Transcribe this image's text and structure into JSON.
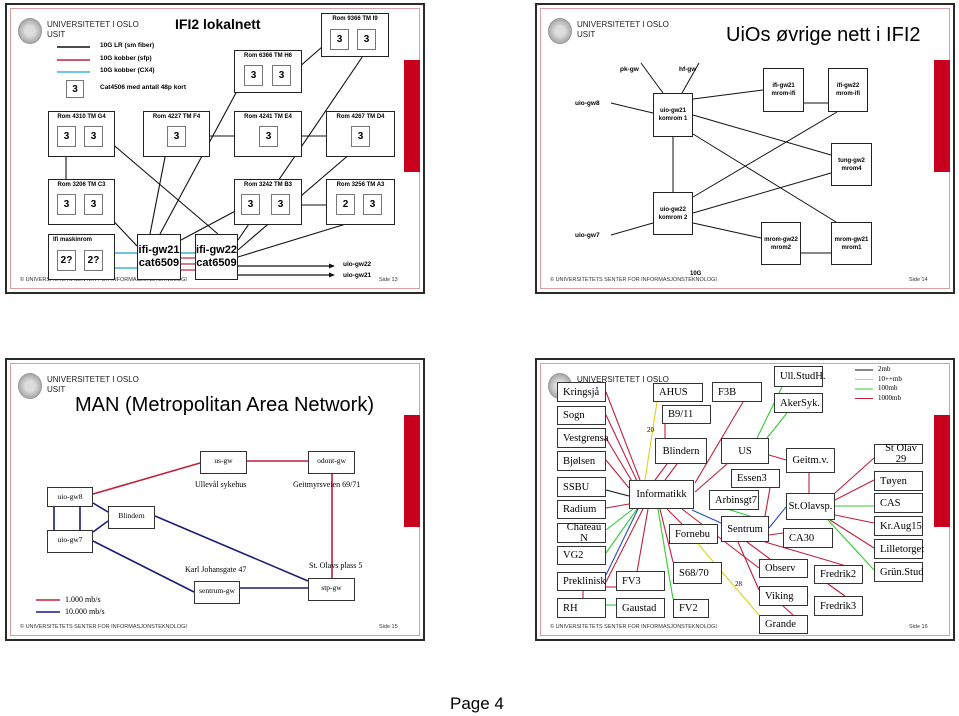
{
  "colors": {
    "accent_bar": "#c8001e",
    "black": "#111111",
    "red": "#c0203a",
    "cyan": "#3cb4dc",
    "navy": "#1c1c78",
    "yellow": "#e0d020",
    "green": "#33cc33",
    "blue": "#2050c0"
  },
  "header": {
    "university": "UNIVERSITETET I OSLO",
    "unit": "USIT"
  },
  "footer": "© UNIVERSITETETS SENTER FOR INFORMASJONSTEKNOLOGI",
  "slides": [
    {
      "title": "IFI2 lokalnett",
      "slide_number": "Side 13",
      "legend": [
        {
          "label": "10G LR (sm fiber)",
          "color": "#111111"
        },
        {
          "label": "10G kobber (sfp)",
          "color": "#c0203a"
        },
        {
          "label": "10G kobber (CX4)",
          "color": "#3cb4dc"
        },
        {
          "label": "Cat4506 med antall 48p kort",
          "symbol": "3"
        }
      ],
      "rooms": [
        {
          "name": "Rom 9366 TM I9",
          "switches": [
            "3",
            "3"
          ]
        },
        {
          "name": "Rom 6366 TM H6",
          "switches": [
            "3",
            "3"
          ]
        },
        {
          "name": "Rom 4310 TM G4",
          "switches": [
            "3",
            "3"
          ]
        },
        {
          "name": "Rom 4227 TM F4",
          "switches": [
            "3"
          ]
        },
        {
          "name": "Rom 4241 TM E4",
          "switches": [
            "3"
          ]
        },
        {
          "name": "Rom 4267 TM D4",
          "switches": [
            "3"
          ]
        },
        {
          "name": "Rom 3206 TM C3",
          "switches": [
            "3",
            "3"
          ]
        },
        {
          "name": "Rom 3242 TM B3",
          "switches": [
            "3",
            "3"
          ]
        },
        {
          "name": "Rom 3256 TM A3",
          "switches": [
            "2",
            "3"
          ]
        },
        {
          "name": "Ifi maskinrom",
          "switches": [
            "2?",
            "2?"
          ]
        }
      ],
      "gateways": [
        "ifi-gw21\ncat6509",
        "ifi-gw22\ncat6509"
      ],
      "uplinks": [
        "uio-gw22",
        "uio-gw21"
      ]
    },
    {
      "title": "UiOs øvrige nett i IFI2",
      "slide_number": "Side 14",
      "nodes": [
        "uio-gw21\nkomrom 1",
        "uio-gw22\nkomrom 2",
        "ifi-gw21\nmrom-ifi",
        "ifi-gw22\nmrom-ifi",
        "tung-gw2\nmrom4",
        "mrom-gw22\nmrom2",
        "mrom-gw21\nmrom1"
      ],
      "external": [
        "pk-gw",
        "hf-gw",
        "uio-gw8",
        "uio-gw7"
      ],
      "annotation": "10G"
    },
    {
      "title": "MAN (Metropolitan Area Network)",
      "slide_number": "Side 15",
      "nodes": [
        "us-gw",
        "odont-gw",
        "uio-gw8",
        "uio-gw7",
        "Blindern",
        "sentrum-gw",
        "stp-gw"
      ],
      "locations": [
        "Ullevål sykehus",
        "Geitmyrsveien 69/71",
        "Karl Johansgate 47",
        "St. Olavs plass 5"
      ],
      "legend": [
        {
          "label": "1.000 mb/s",
          "color": "#c0203a"
        },
        {
          "label": "10.000 mb/s",
          "color": "#1c1c78"
        }
      ]
    },
    {
      "slide_number": "Side 16",
      "legend": [
        {
          "label": "2mb",
          "color": "#111111"
        },
        {
          "label": "10++mb",
          "color": "#e0d020"
        },
        {
          "label": "100mb",
          "color": "#33cc33"
        },
        {
          "label": "1000mb",
          "color": "#c0203a"
        }
      ],
      "nodes": [
        "Kringsjå",
        "Sogn",
        "Vestgrensa",
        "Bjølsen",
        "SSBU",
        "Radium",
        "Chateau N",
        "VG2",
        "Preklinisk",
        "RH",
        "AHUS",
        "B9/11",
        "Blindern",
        "Informatikk",
        "F3B",
        "Ull.StudH.",
        "AkerSyk.",
        "US",
        "Geitm.v.",
        "Essen3",
        "Arbinsgt7",
        "Sentrum",
        "St.Olavsp.",
        "CA30",
        "Fornebu",
        "S68/70",
        "FV3",
        "Gaustad",
        "FV2",
        "Observ",
        "Viking",
        "Grande",
        "Fredrik2",
        "Fredrik3",
        "St Olav 29",
        "Tøyen",
        "CAS",
        "Kr.Aug15",
        "Lilletorget",
        "Grün.Stud"
      ],
      "link_labels": [
        "20",
        "28"
      ]
    }
  ],
  "page_label": "Page 4"
}
